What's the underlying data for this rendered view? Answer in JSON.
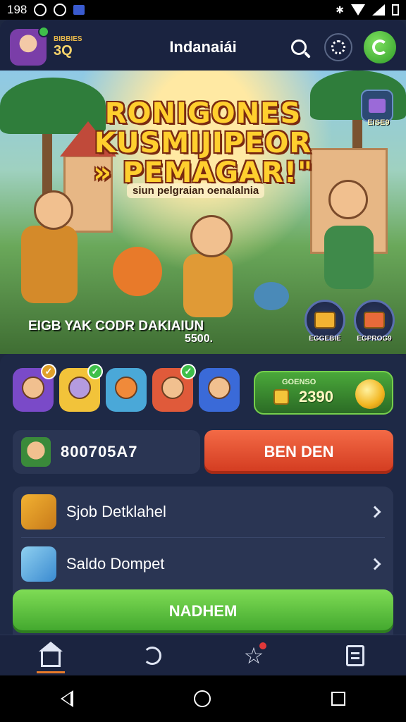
{
  "status_bar": {
    "time": "198"
  },
  "header": {
    "title": "Indanaiái",
    "user_small_text": "BIBBIES",
    "user_level": "3Q"
  },
  "banner": {
    "promo_lines": [
      "RONIGONES",
      "KUSMIJIPEOR",
      "» PEMAGAR!\""
    ],
    "promo_sub": "siun pelgraian oenalalnia",
    "caption": "EIGB YAK CODR DAKIAIUN",
    "amount": "5500.",
    "top_right_label": "EISE9",
    "chest_left_label": "EGGEBIE",
    "chest_right_label": "EGPROG9"
  },
  "coin_card": {
    "label": "GOENSO",
    "amount": "2390"
  },
  "account": {
    "id_text": "800705A7",
    "action_label": "BEN DEN"
  },
  "menu": {
    "items": [
      {
        "label": "Sjob Detklahel"
      },
      {
        "label": "Saldo Dompet"
      }
    ]
  },
  "primary_button": {
    "label": "NADHEM"
  },
  "colors": {
    "accent_green": "#3fa52c",
    "accent_red": "#d23a1f",
    "background": "#1d2740"
  }
}
